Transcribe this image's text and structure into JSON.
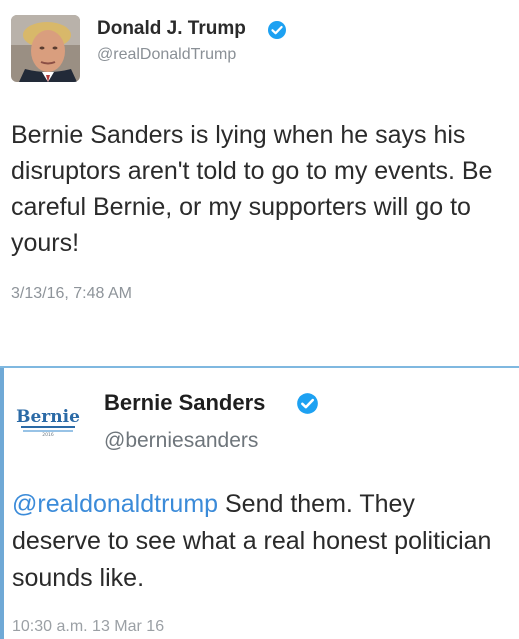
{
  "tweets": [
    {
      "author_name": "Donald J. Trump",
      "author_handle": "@realDonaldTrump",
      "verified": true,
      "avatar_icon": "profile-photo",
      "text": "Bernie Sanders is lying when he says his disruptors aren't told to go to my events. Be careful Bernie, or my supporters will go to yours!",
      "timestamp": "3/13/16, 7:48 AM"
    },
    {
      "author_name": "Bernie Sanders",
      "author_handle": "@berniesanders",
      "verified": true,
      "avatar_icon": "bernie-2016-logo",
      "avatar_logo_text": "Bernie",
      "avatar_logo_subtext": "2016",
      "mention": "@realdonaldtrump",
      "text": " Send them. They deserve to see what a real honest politician sounds like.",
      "timestamp": "10:30 a.m. 13 Mar 16"
    }
  ],
  "colors": {
    "verified_badge": "#1da1f2",
    "mention": "#3b8bd9",
    "divider": "#7fb8e0",
    "bernie_logo": "#2b6aa6"
  }
}
